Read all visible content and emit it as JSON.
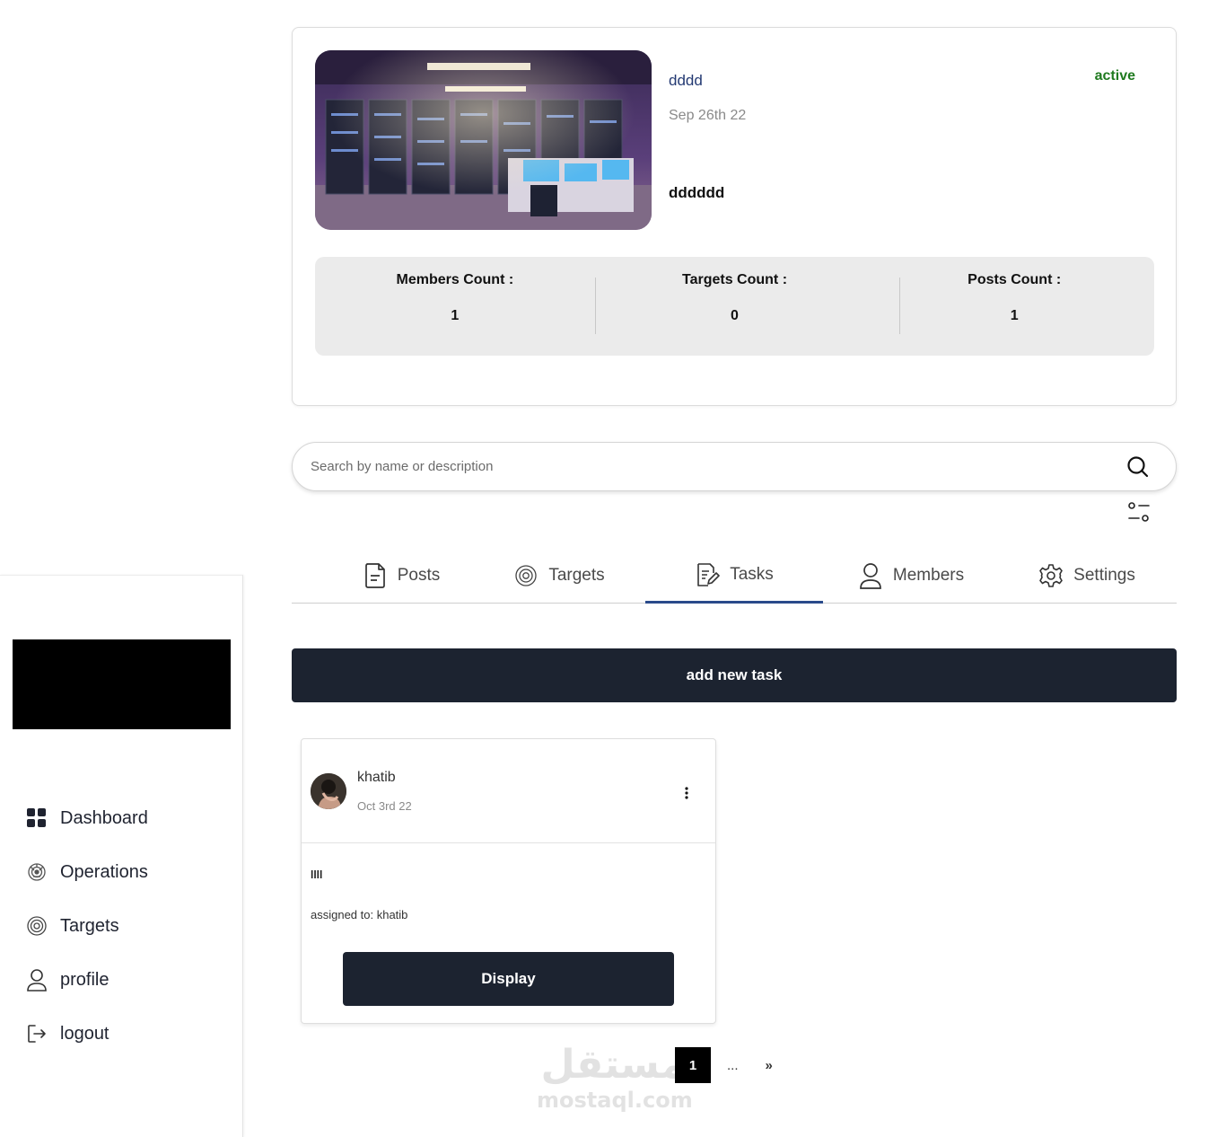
{
  "sidebar": {
    "items": [
      {
        "label": "Dashboard",
        "icon": "dashboard-grid-icon"
      },
      {
        "label": "Operations",
        "icon": "operations-icon"
      },
      {
        "label": "Targets",
        "icon": "target-icon"
      },
      {
        "label": "profile",
        "icon": "user-icon"
      },
      {
        "label": "logout",
        "icon": "logout-icon"
      }
    ]
  },
  "operation": {
    "title": "dddd",
    "date": "Sep 26th 22",
    "description": "dddddd",
    "status": "active",
    "image": "server-room-illustration",
    "stats": [
      {
        "label": "Members Count :",
        "value": "1"
      },
      {
        "label": "Targets Count :",
        "value": "0"
      },
      {
        "label": "Posts Count :",
        "value": "1"
      }
    ]
  },
  "search": {
    "placeholder": "Search by name or description",
    "value": ""
  },
  "tabs": [
    {
      "label": "Posts",
      "icon": "document-icon",
      "active": false
    },
    {
      "label": "Targets",
      "icon": "target-icon",
      "active": false
    },
    {
      "label": "Tasks",
      "icon": "task-edit-icon",
      "active": true
    },
    {
      "label": "Members",
      "icon": "user-icon",
      "active": false
    },
    {
      "label": "Settings",
      "icon": "gear-icon",
      "active": false
    }
  ],
  "add_task_label": "add new task",
  "task": {
    "user": "khatib",
    "date": "Oct 3rd 22",
    "title": "llll",
    "assigned": "assigned to: khatib",
    "display_label": "Display"
  },
  "pagination": {
    "current": "1",
    "ellipsis": "...",
    "next": "»"
  },
  "watermark": {
    "arabic": "مستقل",
    "latin": "mostaql.com"
  },
  "colors": {
    "dark_button": "#1c2330",
    "active_tab": "#2a4a8b",
    "status_active": "#1f7a1f",
    "title_blue": "#243a73"
  }
}
